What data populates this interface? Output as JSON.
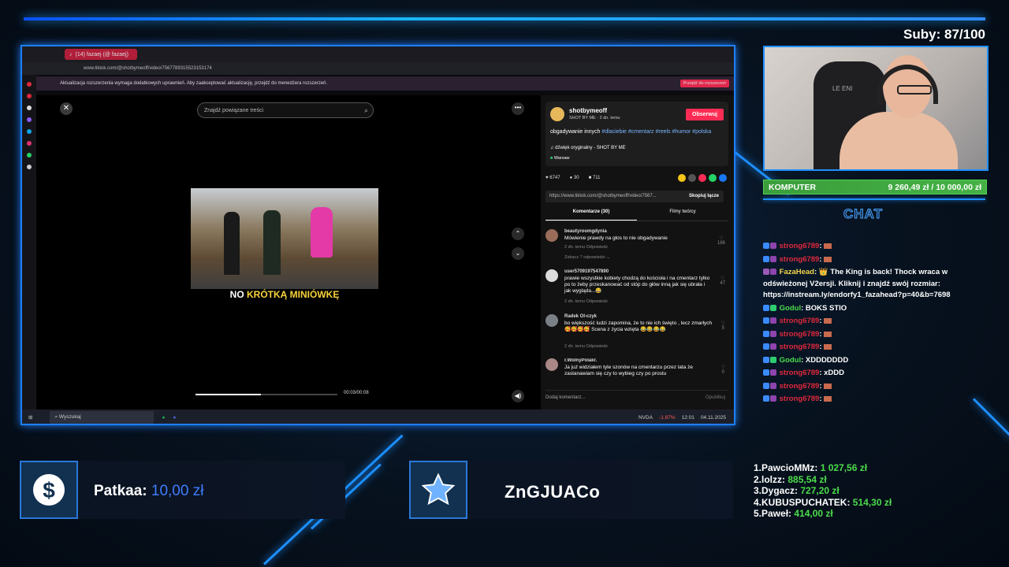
{
  "overlay": {
    "subs": "Suby: 87/100",
    "goal": {
      "label": "KOMPUTER",
      "amount": "9 260,49 zł / 10 000,00 zł",
      "progress": 0.926
    },
    "chat_title": "CHAT",
    "donation": {
      "name": "Patkaa:",
      "amount": "10,00 zł"
    },
    "follower": "ZnGJUACo",
    "top_donors": [
      {
        "rank": "1.",
        "name": "PawcioMMz:",
        "amount": "1 027,56 zł"
      },
      {
        "rank": "2.",
        "name": "lolzz:",
        "amount": "885,54 zł"
      },
      {
        "rank": "3.",
        "name": "Dygacz:",
        "amount": "727,20 zł"
      },
      {
        "rank": "4.",
        "name": "KUBUSPUCHATEK:",
        "amount": "514,30 zł"
      },
      {
        "rank": "5.",
        "name": "Paweł:",
        "amount": "414,00 zł"
      }
    ],
    "webcam_chair_text": "LE  ENI",
    "colors": {
      "accent": "#1e90ff",
      "goal": "#45b145",
      "donation_value": "#3f7dff",
      "top_value": "#4cdc4c",
      "chat_red": "#e0283c",
      "chat_green": "#4cdc4c"
    }
  },
  "chat": [
    {
      "user": "strong6789",
      "sep": ":",
      "msg": "",
      "color": "red"
    },
    {
      "user": "strong6789",
      "sep": ":",
      "msg": "",
      "color": "red"
    },
    {
      "user": "FazaHead",
      "sep": ":",
      "msg": "👑 The King is back! Thock wraca w odświeżonej V2ersji. Kliknij i znajdź swój rozmiar: https://instream.ly/endorfy1_fazahead?p=40&b=7698",
      "color": "yel",
      "multi": true
    },
    {
      "user": "Godul",
      "sep": ":",
      "msg": "BOKS STIO",
      "color": "grn"
    },
    {
      "user": "strong6789",
      "sep": ":",
      "msg": "",
      "color": "red"
    },
    {
      "user": "strong6789",
      "sep": ":",
      "msg": "",
      "color": "red"
    },
    {
      "user": "strong6789",
      "sep": ":",
      "msg": "",
      "color": "red"
    },
    {
      "user": "Godul",
      "sep": ":",
      "msg": "XDDDDDDD",
      "color": "grn"
    },
    {
      "user": "strong6789",
      "sep": ":",
      "msg": "xDDD",
      "color": "red"
    },
    {
      "user": "strong6789",
      "sep": ":",
      "msg": "",
      "color": "red"
    },
    {
      "user": "strong6789",
      "sep": ":",
      "msg": "",
      "color": "red"
    }
  ],
  "browser": {
    "tab_title": "(14) fazaej (@ fazaej)",
    "url": "www.tiktok.com/@shotbymeoff/video/7567789315523153174",
    "notice": "Aktualizacja rozszerzenia wymaga dodatkowych uprawnień. Aby zaakceptować aktualizację, przejdź do menedżera rozszerzeń.",
    "notice_button": "Przejdź do rozszerzeń"
  },
  "tiktok": {
    "search_placeholder": "Znajdź powiązane treści",
    "caption_white": "NO ",
    "caption_yellow": "KRÓTKĄ MINIÓWKĘ",
    "time": "00:03/00:08",
    "progress": 0.46,
    "author": "shotbymeoff",
    "author_sub": "SHOT BY ME · 2 dn. temu",
    "follow": "Obserwuj",
    "desc_text": "obgadywanie innych ",
    "desc_tags": "#dlaciebie #cmentarz #reels #humor #polska",
    "sound": "♫ dźwięk oryginalny - SHOT BY ME",
    "location": "Warsaw",
    "likes": "6747",
    "comments_count": "30",
    "saves": "711",
    "share_url": "https://www.tiktok.com/@shotbymeoff/video/7567...",
    "copy": "Skopiuj łącze",
    "tab_comments": "Komentarze (30)",
    "tab_creator": "Filmy twórcy",
    "comments": [
      {
        "user": "beautyroomgdynia",
        "text": "Mówienie prawdy na głos to nie obgadywanie",
        "meta": "2 dn. temu   Odpowiedz",
        "more": "Zobacz 7 odpowiedzi ⌄",
        "likes": "186"
      },
      {
        "user": "user5709197547890",
        "text": "prawie wszystkie kobiety chodzą do kościoła i na cmentarz tylko po to żeby przeskanować od stóp do głów inną jak się ubrała i jak wygląda...😂",
        "meta": "2 dn. temu   Odpowiedz",
        "likes": "47"
      },
      {
        "user": "Radek Ol-czyk",
        "text": "bo większość ludzi zapomina, że to nie ich święto , lecz zmarłych 🥰🥰🥰🥰 Scena z życia wzięta 😂😂😂😂",
        "meta": "2 dn. temu   Odpowiedz",
        "likes": "5"
      },
      {
        "user": "r.WolnyPolakr.",
        "text": "Ja już widziałem tyle szonów na cmentarzu przez lata że zastanawiam się czy to wybieg czy po prostu",
        "meta": "",
        "likes": "0"
      }
    ],
    "add_comment": "Dodaj komentarz...",
    "publish": "Opublikuj"
  },
  "taskbar": {
    "search": "Wyszukaj",
    "stock": "NVDA",
    "stock_change": "-1.87%",
    "time": "12:01",
    "date": "04.11.2025"
  }
}
